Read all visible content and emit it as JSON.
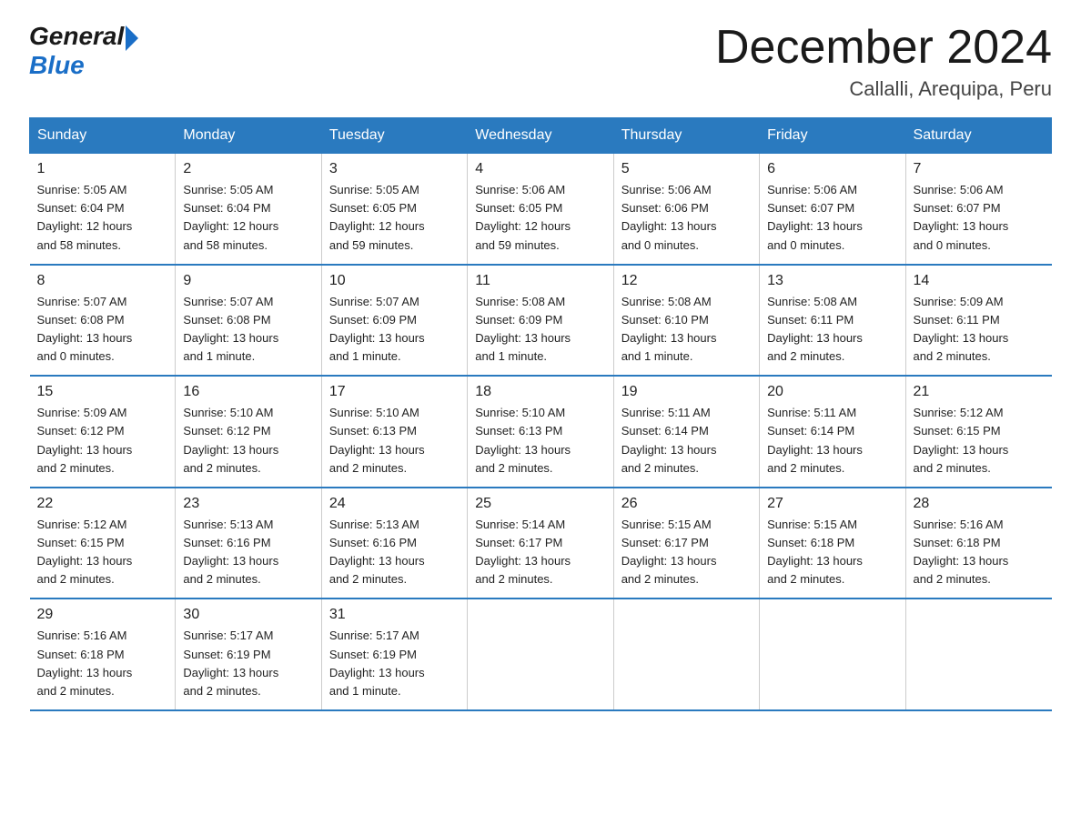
{
  "logo": {
    "general": "General",
    "blue": "Blue"
  },
  "header": {
    "month_year": "December 2024",
    "location": "Callalli, Arequipa, Peru"
  },
  "days_of_week": [
    "Sunday",
    "Monday",
    "Tuesday",
    "Wednesday",
    "Thursday",
    "Friday",
    "Saturday"
  ],
  "weeks": [
    [
      {
        "day": "1",
        "sunrise": "5:05 AM",
        "sunset": "6:04 PM",
        "daylight": "12 hours and 58 minutes."
      },
      {
        "day": "2",
        "sunrise": "5:05 AM",
        "sunset": "6:04 PM",
        "daylight": "12 hours and 58 minutes."
      },
      {
        "day": "3",
        "sunrise": "5:05 AM",
        "sunset": "6:05 PM",
        "daylight": "12 hours and 59 minutes."
      },
      {
        "day": "4",
        "sunrise": "5:06 AM",
        "sunset": "6:05 PM",
        "daylight": "12 hours and 59 minutes."
      },
      {
        "day": "5",
        "sunrise": "5:06 AM",
        "sunset": "6:06 PM",
        "daylight": "13 hours and 0 minutes."
      },
      {
        "day": "6",
        "sunrise": "5:06 AM",
        "sunset": "6:07 PM",
        "daylight": "13 hours and 0 minutes."
      },
      {
        "day": "7",
        "sunrise": "5:06 AM",
        "sunset": "6:07 PM",
        "daylight": "13 hours and 0 minutes."
      }
    ],
    [
      {
        "day": "8",
        "sunrise": "5:07 AM",
        "sunset": "6:08 PM",
        "daylight": "13 hours and 0 minutes."
      },
      {
        "day": "9",
        "sunrise": "5:07 AM",
        "sunset": "6:08 PM",
        "daylight": "13 hours and 1 minute."
      },
      {
        "day": "10",
        "sunrise": "5:07 AM",
        "sunset": "6:09 PM",
        "daylight": "13 hours and 1 minute."
      },
      {
        "day": "11",
        "sunrise": "5:08 AM",
        "sunset": "6:09 PM",
        "daylight": "13 hours and 1 minute."
      },
      {
        "day": "12",
        "sunrise": "5:08 AM",
        "sunset": "6:10 PM",
        "daylight": "13 hours and 1 minute."
      },
      {
        "day": "13",
        "sunrise": "5:08 AM",
        "sunset": "6:11 PM",
        "daylight": "13 hours and 2 minutes."
      },
      {
        "day": "14",
        "sunrise": "5:09 AM",
        "sunset": "6:11 PM",
        "daylight": "13 hours and 2 minutes."
      }
    ],
    [
      {
        "day": "15",
        "sunrise": "5:09 AM",
        "sunset": "6:12 PM",
        "daylight": "13 hours and 2 minutes."
      },
      {
        "day": "16",
        "sunrise": "5:10 AM",
        "sunset": "6:12 PM",
        "daylight": "13 hours and 2 minutes."
      },
      {
        "day": "17",
        "sunrise": "5:10 AM",
        "sunset": "6:13 PM",
        "daylight": "13 hours and 2 minutes."
      },
      {
        "day": "18",
        "sunrise": "5:10 AM",
        "sunset": "6:13 PM",
        "daylight": "13 hours and 2 minutes."
      },
      {
        "day": "19",
        "sunrise": "5:11 AM",
        "sunset": "6:14 PM",
        "daylight": "13 hours and 2 minutes."
      },
      {
        "day": "20",
        "sunrise": "5:11 AM",
        "sunset": "6:14 PM",
        "daylight": "13 hours and 2 minutes."
      },
      {
        "day": "21",
        "sunrise": "5:12 AM",
        "sunset": "6:15 PM",
        "daylight": "13 hours and 2 minutes."
      }
    ],
    [
      {
        "day": "22",
        "sunrise": "5:12 AM",
        "sunset": "6:15 PM",
        "daylight": "13 hours and 2 minutes."
      },
      {
        "day": "23",
        "sunrise": "5:13 AM",
        "sunset": "6:16 PM",
        "daylight": "13 hours and 2 minutes."
      },
      {
        "day": "24",
        "sunrise": "5:13 AM",
        "sunset": "6:16 PM",
        "daylight": "13 hours and 2 minutes."
      },
      {
        "day": "25",
        "sunrise": "5:14 AM",
        "sunset": "6:17 PM",
        "daylight": "13 hours and 2 minutes."
      },
      {
        "day": "26",
        "sunrise": "5:15 AM",
        "sunset": "6:17 PM",
        "daylight": "13 hours and 2 minutes."
      },
      {
        "day": "27",
        "sunrise": "5:15 AM",
        "sunset": "6:18 PM",
        "daylight": "13 hours and 2 minutes."
      },
      {
        "day": "28",
        "sunrise": "5:16 AM",
        "sunset": "6:18 PM",
        "daylight": "13 hours and 2 minutes."
      }
    ],
    [
      {
        "day": "29",
        "sunrise": "5:16 AM",
        "sunset": "6:18 PM",
        "daylight": "13 hours and 2 minutes."
      },
      {
        "day": "30",
        "sunrise": "5:17 AM",
        "sunset": "6:19 PM",
        "daylight": "13 hours and 2 minutes."
      },
      {
        "day": "31",
        "sunrise": "5:17 AM",
        "sunset": "6:19 PM",
        "daylight": "13 hours and 1 minute."
      },
      null,
      null,
      null,
      null
    ]
  ]
}
